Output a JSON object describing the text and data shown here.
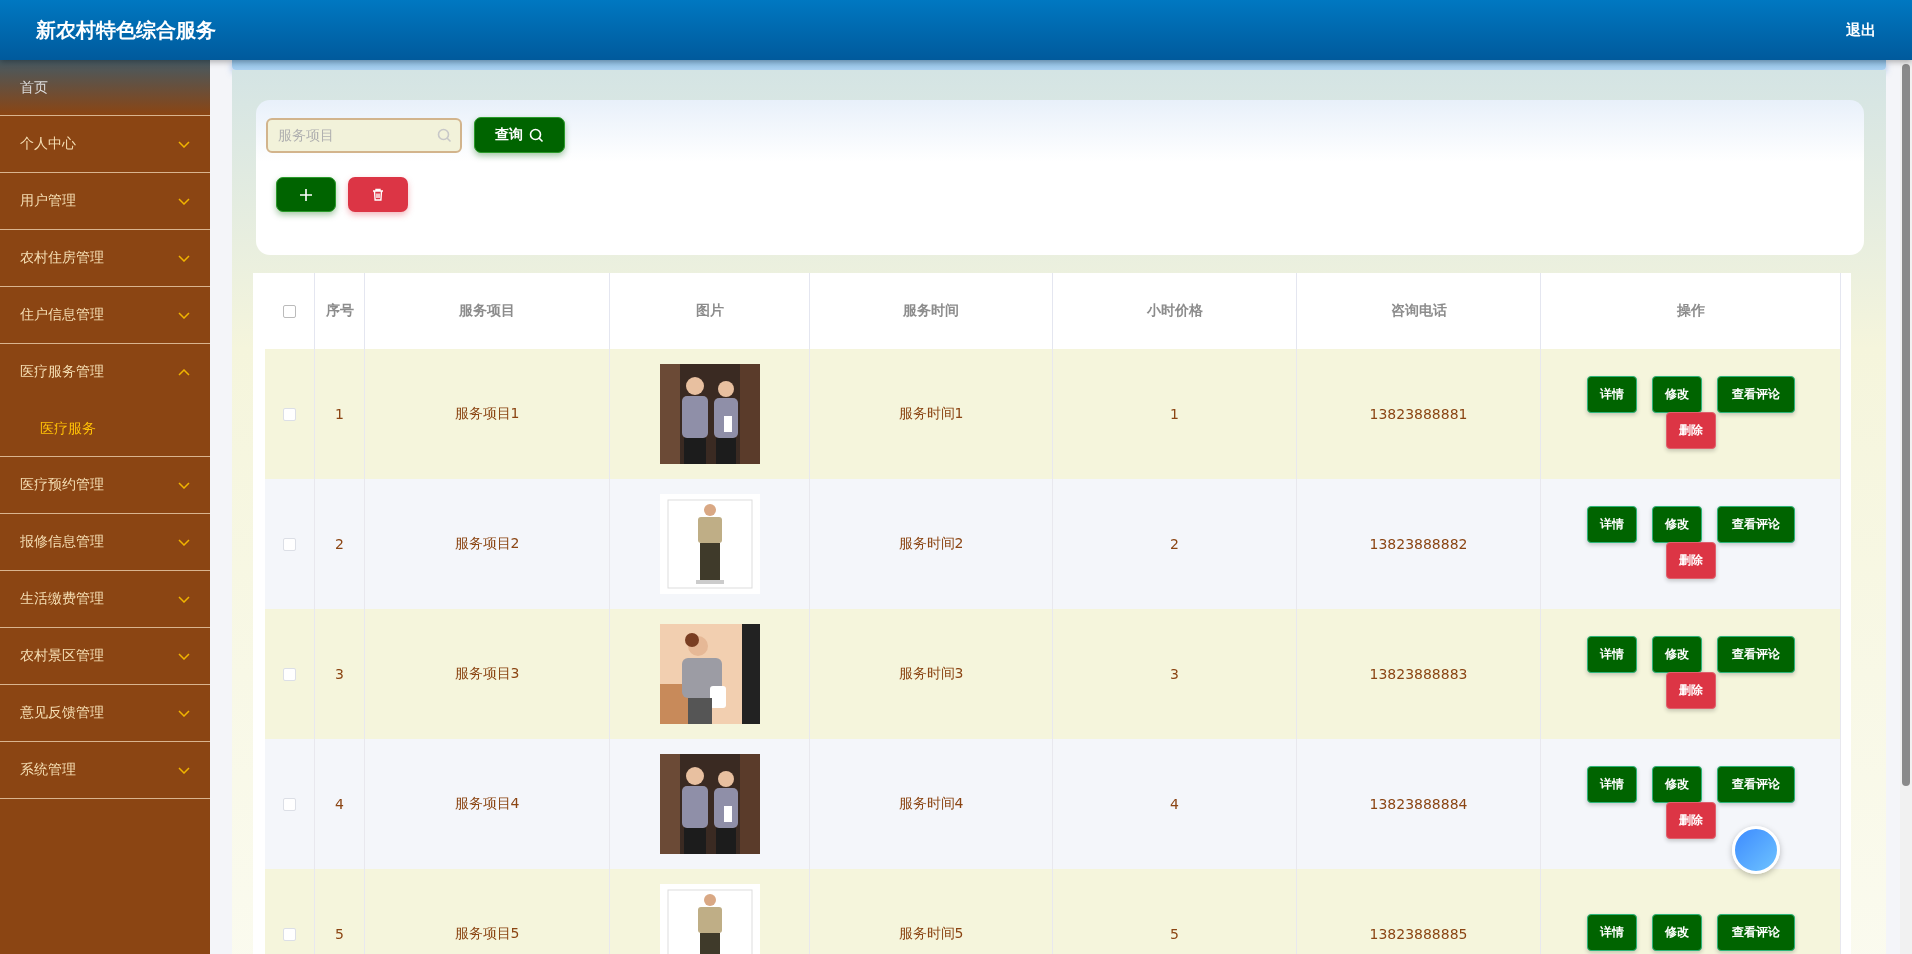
{
  "header": {
    "title": "新农村特色综合服务",
    "logout": "退出"
  },
  "sidebar": {
    "items": [
      {
        "kind": "link",
        "label": "首页"
      },
      {
        "kind": "menu",
        "label": "个人中心",
        "expanded": false
      },
      {
        "kind": "menu",
        "label": "用户管理",
        "expanded": false
      },
      {
        "kind": "menu",
        "label": "农村住房管理",
        "expanded": false
      },
      {
        "kind": "menu",
        "label": "住户信息管理",
        "expanded": false
      },
      {
        "kind": "menu",
        "label": "医疗服务管理",
        "expanded": true,
        "children": [
          {
            "label": "医疗服务",
            "selected": true
          }
        ]
      },
      {
        "kind": "menu",
        "label": "医疗预约管理",
        "expanded": false
      },
      {
        "kind": "menu",
        "label": "报修信息管理",
        "expanded": false
      },
      {
        "kind": "menu",
        "label": "生活缴费管理",
        "expanded": false
      },
      {
        "kind": "menu",
        "label": "农村景区管理",
        "expanded": false
      },
      {
        "kind": "menu",
        "label": "意见反馈管理",
        "expanded": false
      },
      {
        "kind": "menu",
        "label": "系统管理",
        "expanded": false
      }
    ]
  },
  "search": {
    "placeholder": "服务项目",
    "button": "查询"
  },
  "table": {
    "select_all": false,
    "columns": [
      "序号",
      "服务项目",
      "图片",
      "服务时间",
      "小时价格",
      "咨询电话",
      "操作"
    ],
    "rows": [
      {
        "checked": false,
        "index": "1",
        "name": "服务项目1",
        "image": {
          "kind": "picture"
        },
        "time": "服务时间1",
        "price": "1",
        "phone": "13823888881",
        "actions": [
          {
            "kind": "primary",
            "label": "详情"
          },
          {
            "kind": "primary",
            "label": "修改"
          },
          {
            "kind": "primary",
            "label": "查看评论"
          },
          {
            "kind": "danger",
            "label": "删除"
          }
        ]
      },
      {
        "checked": false,
        "index": "2",
        "name": "服务项目2",
        "image": {
          "kind": "picture"
        },
        "time": "服务时间2",
        "price": "2",
        "phone": "13823888882",
        "actions": [
          {
            "kind": "primary",
            "label": "详情"
          },
          {
            "kind": "primary",
            "label": "修改"
          },
          {
            "kind": "primary",
            "label": "查看评论"
          },
          {
            "kind": "danger",
            "label": "删除"
          }
        ]
      },
      {
        "checked": false,
        "index": "3",
        "name": "服务项目3",
        "image": {
          "kind": "picture"
        },
        "time": "服务时间3",
        "price": "3",
        "phone": "13823888883",
        "actions": [
          {
            "kind": "primary",
            "label": "详情"
          },
          {
            "kind": "primary",
            "label": "修改"
          },
          {
            "kind": "primary",
            "label": "查看评论"
          },
          {
            "kind": "danger",
            "label": "删除"
          }
        ]
      },
      {
        "checked": false,
        "index": "4",
        "name": "服务项目4",
        "image": {
          "kind": "picture"
        },
        "time": "服务时间4",
        "price": "4",
        "phone": "13823888884",
        "actions": [
          {
            "kind": "primary",
            "label": "详情"
          },
          {
            "kind": "primary",
            "label": "修改"
          },
          {
            "kind": "primary",
            "label": "查看评论"
          },
          {
            "kind": "danger",
            "label": "删除"
          }
        ]
      },
      {
        "checked": false,
        "index": "5",
        "name": "服务项目5",
        "image": {
          "kind": "picture"
        },
        "time": "服务时间5",
        "price": "5",
        "phone": "13823888885",
        "actions": [
          {
            "kind": "primary",
            "label": "详情"
          },
          {
            "kind": "primary",
            "label": "修改"
          },
          {
            "kind": "primary",
            "label": "查看评论"
          }
        ]
      }
    ]
  }
}
